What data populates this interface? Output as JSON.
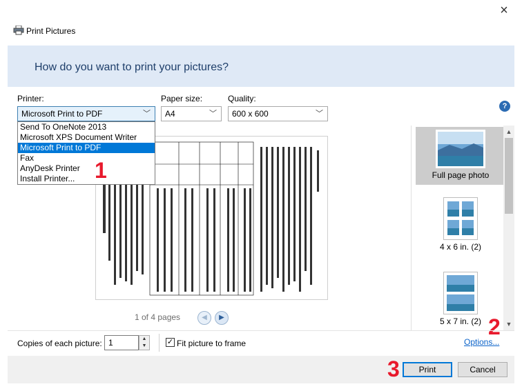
{
  "window": {
    "title": "Print Pictures",
    "close_glyph": "×"
  },
  "header": {
    "heading": "How do you want to print your pictures?"
  },
  "printer": {
    "label": "Printer:",
    "selected": "Microsoft Print to PDF",
    "options": [
      "Send To OneNote 2013",
      "Microsoft XPS Document Writer",
      "Microsoft Print to PDF",
      "Fax",
      "AnyDesk Printer",
      "Install Printer..."
    ],
    "selected_index": 2
  },
  "paper": {
    "label": "Paper size:",
    "selected": "A4"
  },
  "quality": {
    "label": "Quality:",
    "selected": "600 x 600"
  },
  "help_glyph": "?",
  "steps": {
    "one": "1",
    "two": "2",
    "three": "3"
  },
  "preview": {
    "page_counter": "1 of 4 pages",
    "prev_glyph": "◀",
    "next_glyph": "▶"
  },
  "layouts": [
    {
      "label": "Full page photo",
      "selected": true
    },
    {
      "label": "4 x 6 in. (2)",
      "selected": false
    },
    {
      "label": "5 x 7 in. (2)",
      "selected": false
    }
  ],
  "copies": {
    "label": "Copies of each picture:",
    "value": "1"
  },
  "fit": {
    "label": "Fit picture to frame",
    "checked": true,
    "check_glyph": "✓"
  },
  "options_link": "Options...",
  "buttons": {
    "print": "Print",
    "cancel": "Cancel"
  },
  "colors": {
    "accent": "#0078d7",
    "header_band": "#dfe9f6",
    "heading_text": "#1e3e6a",
    "step_red": "#e8192c",
    "link": "#0a62c9"
  }
}
